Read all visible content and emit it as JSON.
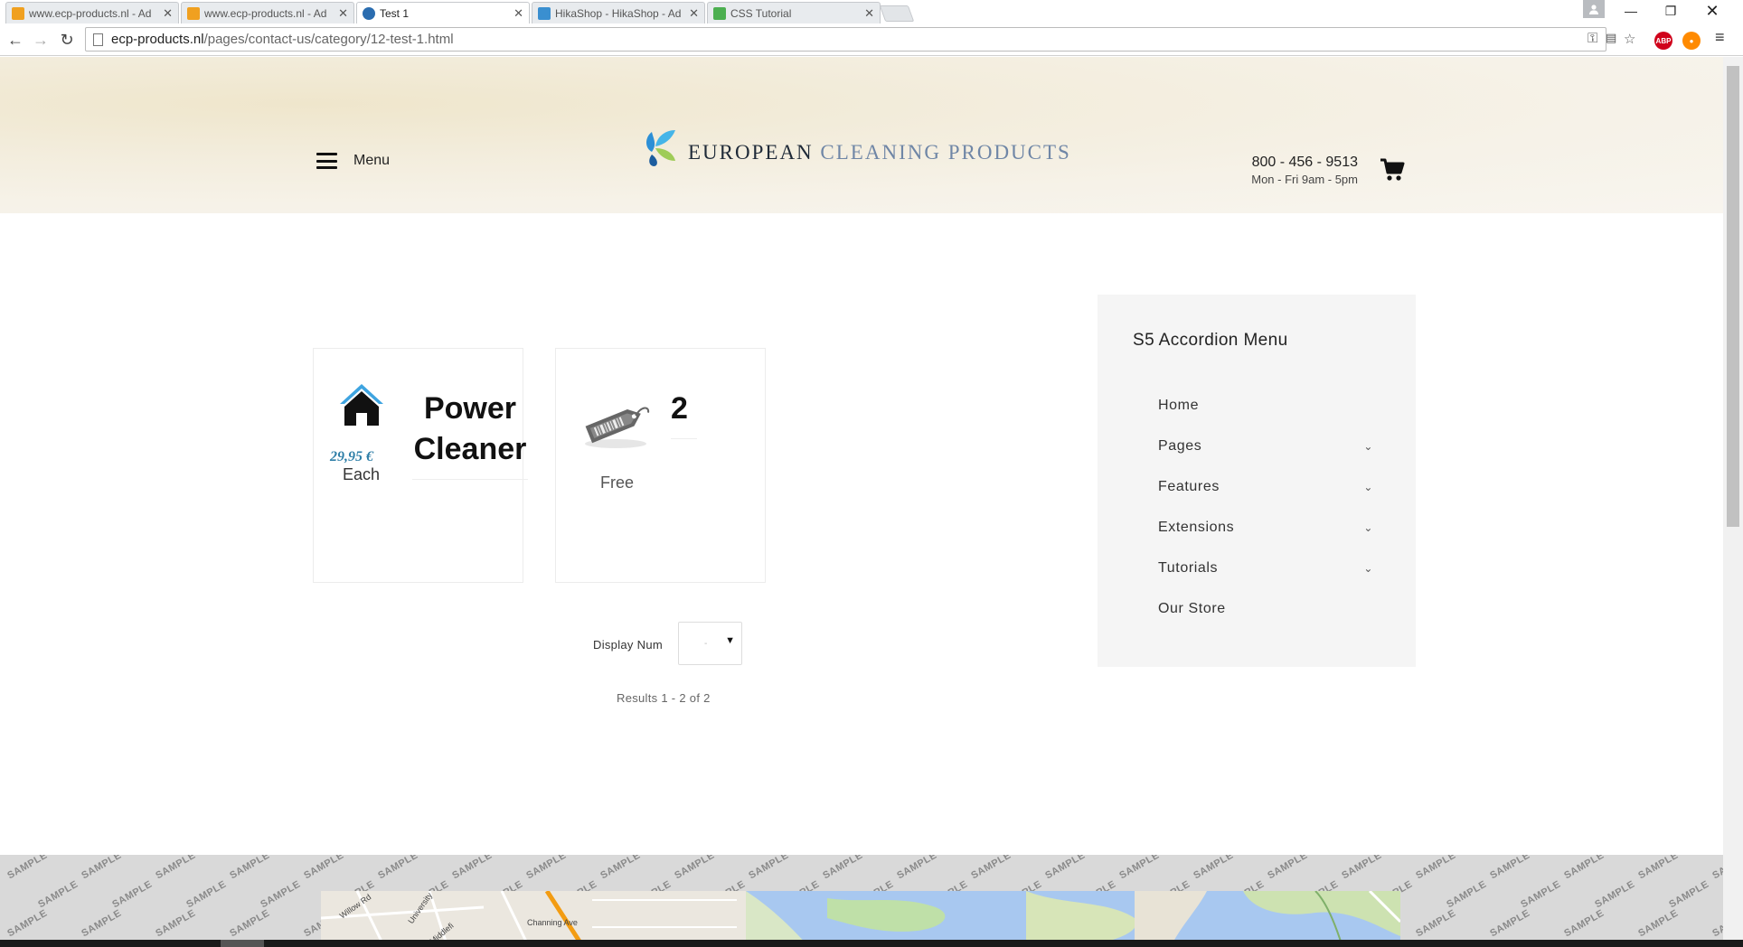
{
  "browser": {
    "tabs": [
      {
        "title": "www.ecp-products.nl - Ad",
        "active": false
      },
      {
        "title": "www.ecp-products.nl - Ad",
        "active": false
      },
      {
        "title": "Test 1",
        "active": true
      },
      {
        "title": "HikaShop - HikaShop - Ad",
        "active": false
      },
      {
        "title": "CSS Tutorial",
        "active": false
      }
    ],
    "url_host": "ecp-products.nl",
    "url_path": "/pages/contact-us/category/12-test-1.html",
    "abp_label": "ABP"
  },
  "header": {
    "menu_label": "Menu",
    "logo_word1": "EUROPEAN",
    "logo_word2": "CLEANING PRODUCTS",
    "phone": "800 - 456 - 9513",
    "hours": "Mon - Fri 9am - 5pm"
  },
  "products": [
    {
      "title": "Power Cleaner",
      "price": "29,95 €",
      "unit": "Each"
    },
    {
      "title": "2",
      "price_label": "Free"
    }
  ],
  "pagination": {
    "display_label": "Display Num",
    "selected": "-",
    "results": "Results 1 - 2 of 2"
  },
  "sidebar": {
    "title": "S5 Accordion Menu",
    "items": [
      {
        "label": "Home",
        "has_children": false
      },
      {
        "label": "Pages",
        "has_children": true
      },
      {
        "label": "Features",
        "has_children": true
      },
      {
        "label": "Extensions",
        "has_children": true
      },
      {
        "label": "Tutorials",
        "has_children": true
      },
      {
        "label": "Our Store",
        "has_children": false
      }
    ]
  },
  "footer": {
    "watermark": "SAMPLE",
    "map_labels": [
      "Willow Rd",
      "University",
      "Middlefi",
      "Channing Ave"
    ]
  },
  "colors": {
    "accent_price": "#2f7fa8",
    "logo_dark": "#1f2a38",
    "logo_light": "#6f86a6",
    "abp_red": "#d0021b"
  }
}
